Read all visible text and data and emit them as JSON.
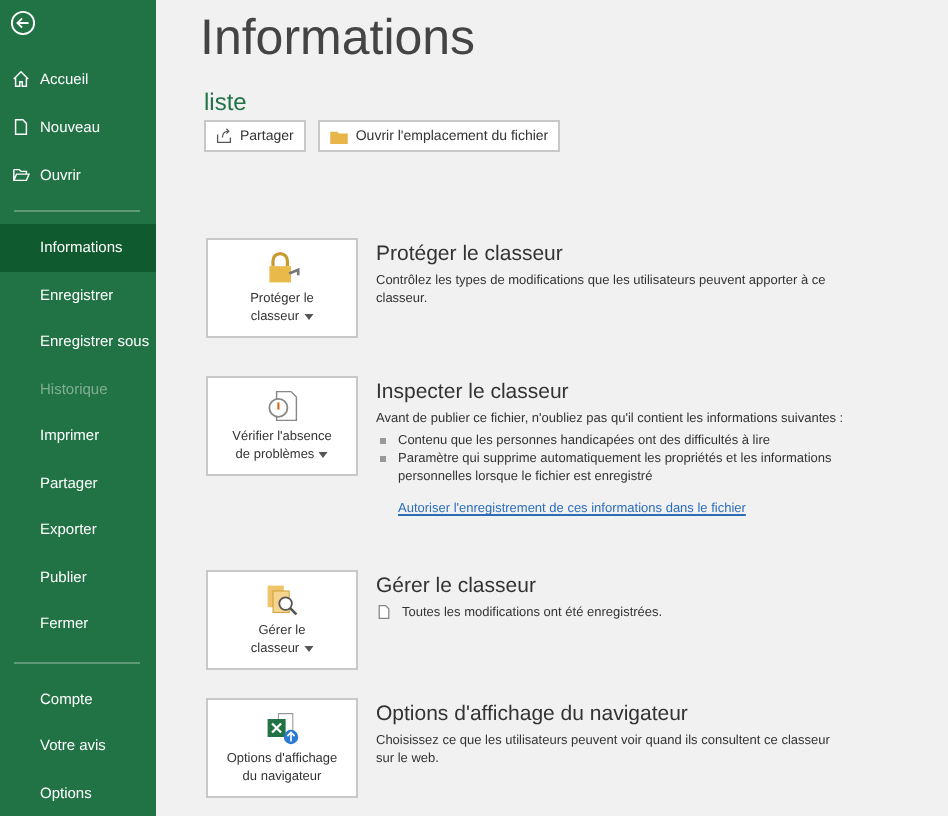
{
  "sidebar": {
    "primary": [
      {
        "label": "Accueil"
      },
      {
        "label": "Nouveau"
      },
      {
        "label": "Ouvrir"
      }
    ],
    "items": [
      {
        "label": "Informations",
        "selected": true,
        "disabled": false
      },
      {
        "label": "Enregistrer",
        "selected": false,
        "disabled": false
      },
      {
        "label": "Enregistrer sous",
        "selected": false,
        "disabled": false
      },
      {
        "label": "Historique",
        "selected": false,
        "disabled": true
      },
      {
        "label": "Imprimer",
        "selected": false,
        "disabled": false
      },
      {
        "label": "Partager",
        "selected": false,
        "disabled": false
      },
      {
        "label": "Exporter",
        "selected": false,
        "disabled": false
      },
      {
        "label": "Publier",
        "selected": false,
        "disabled": false
      },
      {
        "label": "Fermer",
        "selected": false,
        "disabled": false
      }
    ],
    "footer": [
      {
        "label": "Compte"
      },
      {
        "label": "Votre avis"
      },
      {
        "label": "Options"
      }
    ]
  },
  "title": "Informations",
  "file_name": "liste",
  "actions": [
    {
      "label": "Partager"
    },
    {
      "label": "Ouvrir l'emplacement du fichier"
    }
  ],
  "sections": [
    {
      "card_lines": [
        "Protéger le",
        "classeur"
      ],
      "dropdown": true,
      "heading": "Protéger le classeur",
      "description": "Contrôlez les types de modifications que les utilisateurs peuvent apporter à ce classeur."
    },
    {
      "card_lines": [
        "Vérifier l'absence",
        "de problèmes"
      ],
      "dropdown": true,
      "heading": "Inspecter le classeur",
      "description": "Avant de publier ce fichier, n'oubliez pas qu'il contient les informations suivantes :",
      "bullets": [
        "Contenu que les personnes handicapées ont des difficultés à lire",
        "Paramètre qui supprime automatiquement les propriétés et les informations personnelles lorsque le fichier est enregistré"
      ],
      "link": "Autoriser l'enregistrement de ces informations dans le fichier"
    },
    {
      "card_lines": [
        "Gérer le",
        "classeur"
      ],
      "dropdown": true,
      "heading": "Gérer le classeur",
      "status": "Toutes les modifications ont été enregistrées."
    },
    {
      "card_lines": [
        "Options d'affichage",
        "du navigateur"
      ],
      "dropdown": false,
      "heading": "Options d'affichage du navigateur",
      "description": "Choisissez ce que les utilisateurs peuvent voir quand ils consultent ce classeur sur le web."
    }
  ]
}
